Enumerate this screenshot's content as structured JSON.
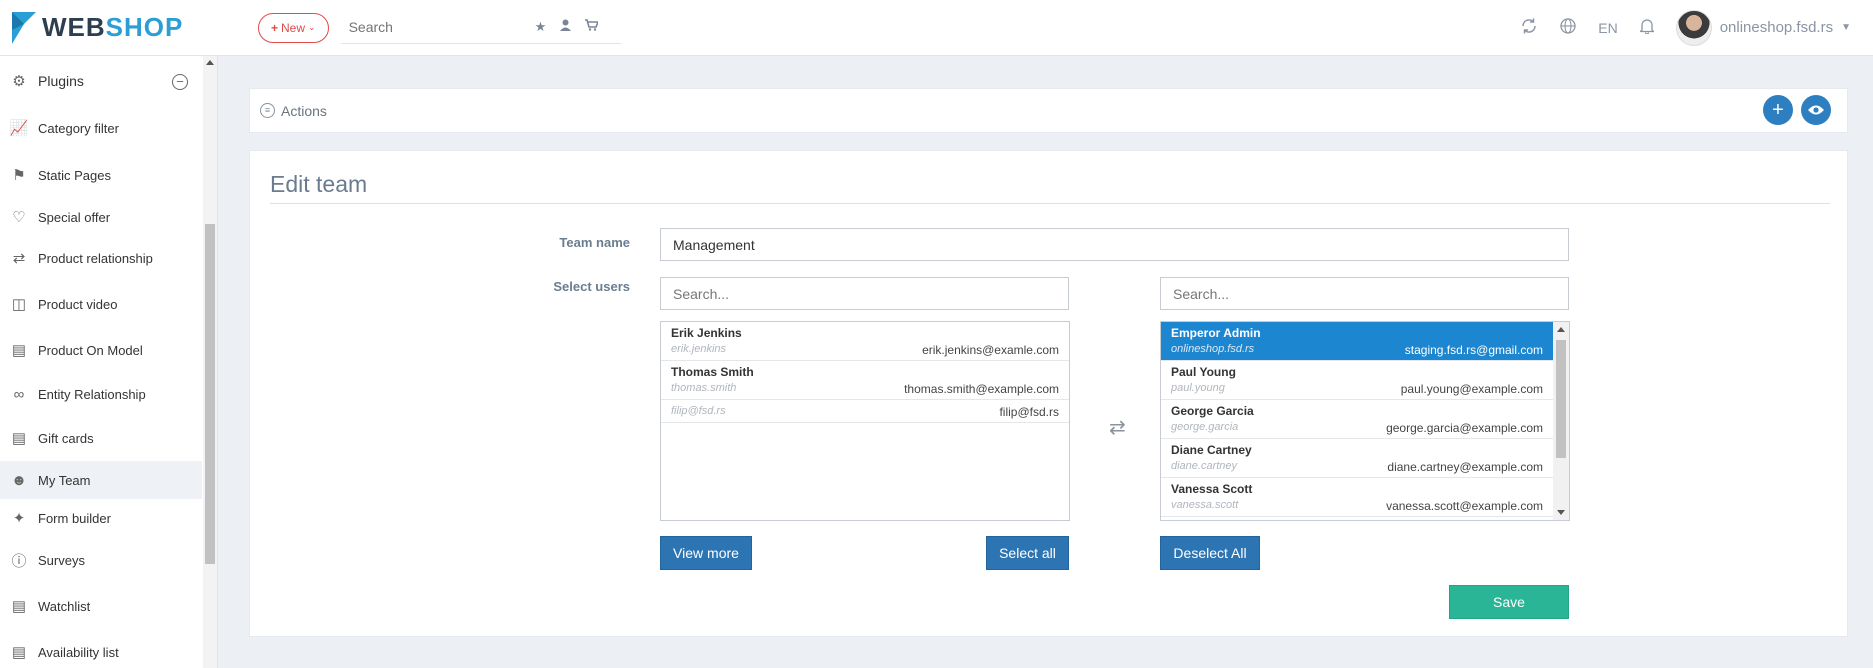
{
  "header": {
    "logo_web": "WEB",
    "logo_shop": "SHOP",
    "new_label": "New",
    "search_placeholder": "Search",
    "language": "EN",
    "user_name": "onlineshop.fsd.rs"
  },
  "sidebar": {
    "section_label": "Plugins",
    "items": [
      {
        "label": "Category filter",
        "icon": "chart-icon"
      },
      {
        "label": "Static Pages",
        "icon": "bookmark-icon"
      },
      {
        "label": "Special offer",
        "icon": "heart-icon"
      },
      {
        "label": "Product relationship",
        "icon": "shuffle-icon"
      },
      {
        "label": "Product video",
        "icon": "video-icon"
      },
      {
        "label": "Product On Model",
        "icon": "image-icon"
      },
      {
        "label": "Entity Relationship",
        "icon": "link-icon"
      },
      {
        "label": "Gift cards",
        "icon": "gift-icon"
      },
      {
        "label": "My Team",
        "icon": "users-icon"
      },
      {
        "label": "Form builder",
        "icon": "magic-icon"
      },
      {
        "label": "Surveys",
        "icon": "question-icon"
      },
      {
        "label": "Watchlist",
        "icon": "clipboard-icon"
      },
      {
        "label": "Availability list",
        "icon": "clipboard-icon"
      }
    ]
  },
  "actions": {
    "label": "Actions"
  },
  "form": {
    "title": "Edit team",
    "team_name_label": "Team name",
    "team_name_value": "Management",
    "select_users_label": "Select users",
    "left_search_placeholder": "Search...",
    "right_search_placeholder": "Search...",
    "available_users": [
      {
        "name": "Erik Jenkins",
        "username": "erik.jenkins",
        "email": "erik.jenkins@examle.com"
      },
      {
        "name": "Thomas Smith",
        "username": "thomas.smith",
        "email": "thomas.smith@example.com"
      },
      {
        "name": "",
        "username": "filip@fsd.rs",
        "email": "filip@fsd.rs"
      }
    ],
    "selected_users": [
      {
        "name": "Emperor Admin",
        "username": "onlineshop.fsd.rs",
        "email": "staging.fsd.rs@gmail.com"
      },
      {
        "name": "Paul Young",
        "username": "paul.young",
        "email": "paul.young@example.com"
      },
      {
        "name": "George Garcia",
        "username": "george.garcia",
        "email": "george.garcia@example.com"
      },
      {
        "name": "Diane Cartney",
        "username": "diane.cartney",
        "email": "diane.cartney@example.com"
      },
      {
        "name": "Vanessa Scott",
        "username": "vanessa.scott",
        "email": "vanessa.scott@example.com"
      }
    ],
    "view_more_label": "View more",
    "select_all_label": "Select all",
    "deselect_all_label": "Deselect All",
    "save_label": "Save"
  },
  "colors": {
    "accent": "#2d74b3",
    "save": "#2ab596",
    "selected_row": "#1c86d0",
    "new_button": "#e04a4a"
  }
}
